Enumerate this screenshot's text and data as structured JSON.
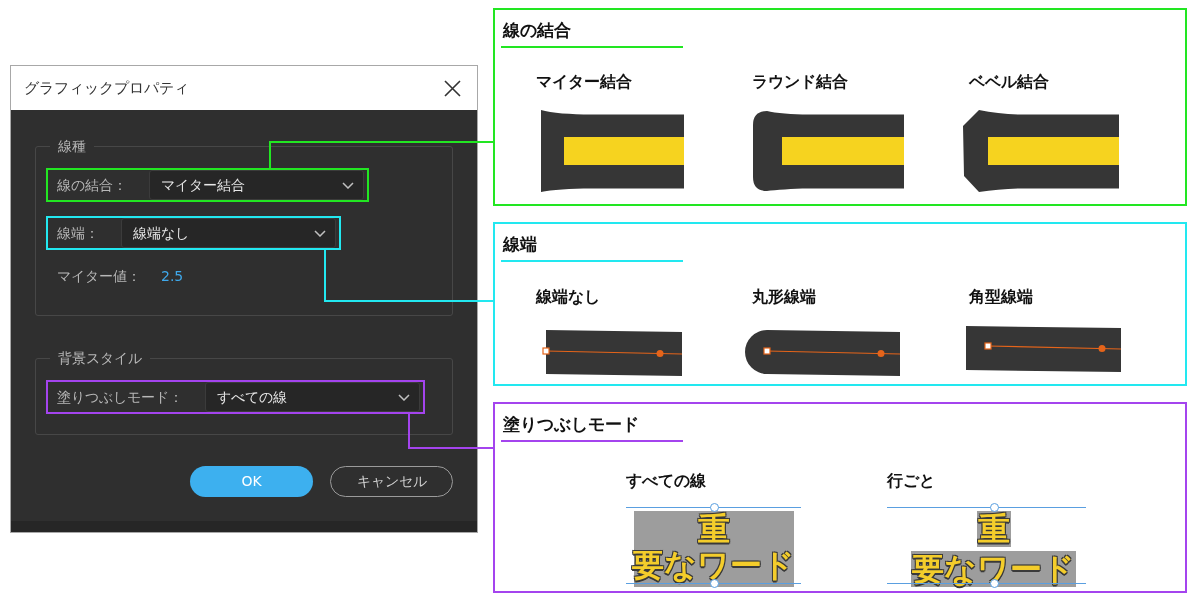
{
  "dialog": {
    "title": "グラフィックプロパティ",
    "groups": [
      {
        "legend": "線種",
        "rows": [
          {
            "kind": "dropdown",
            "label": "線の結合：",
            "value": "マイター結合",
            "color": "#22e622"
          },
          {
            "kind": "dropdown",
            "label": "線端：",
            "value": "線端なし",
            "color": "#22e8f0"
          },
          {
            "kind": "value",
            "label": "マイター値：",
            "value": "2.5"
          }
        ]
      },
      {
        "legend": "背景スタイル",
        "rows": [
          {
            "kind": "dropdown",
            "label": "塗りつぶしモード：",
            "value": "すべての線",
            "color": "#a444ee"
          }
        ]
      }
    ],
    "buttons": [
      {
        "kind": "primary",
        "label": "OK"
      },
      {
        "kind": "secondary",
        "label": "キャンセル"
      }
    ]
  },
  "callouts": [
    {
      "kind": "join",
      "title": "線の結合",
      "color": "#22e622",
      "options": [
        {
          "kind": "miter",
          "label": "マイター結合"
        },
        {
          "kind": "round",
          "label": "ラウンド結合"
        },
        {
          "kind": "bevel",
          "label": "ベベル結合"
        }
      ]
    },
    {
      "kind": "cap",
      "title": "線端",
      "color": "#22e8f0",
      "options": [
        {
          "kind": "butt",
          "label": "線端なし"
        },
        {
          "kind": "round",
          "label": "丸形線端"
        },
        {
          "kind": "square",
          "label": "角型線端"
        }
      ]
    },
    {
      "kind": "fill",
      "title": "塗りつぶしモード",
      "color": "#a444ee",
      "options": [
        {
          "kind": "all_lines",
          "label": "すべての線",
          "sample": [
            "重",
            "要なワード"
          ]
        },
        {
          "kind": "per_line",
          "label": "行ごと",
          "sample": [
            "重",
            "要なワード"
          ]
        }
      ]
    }
  ]
}
